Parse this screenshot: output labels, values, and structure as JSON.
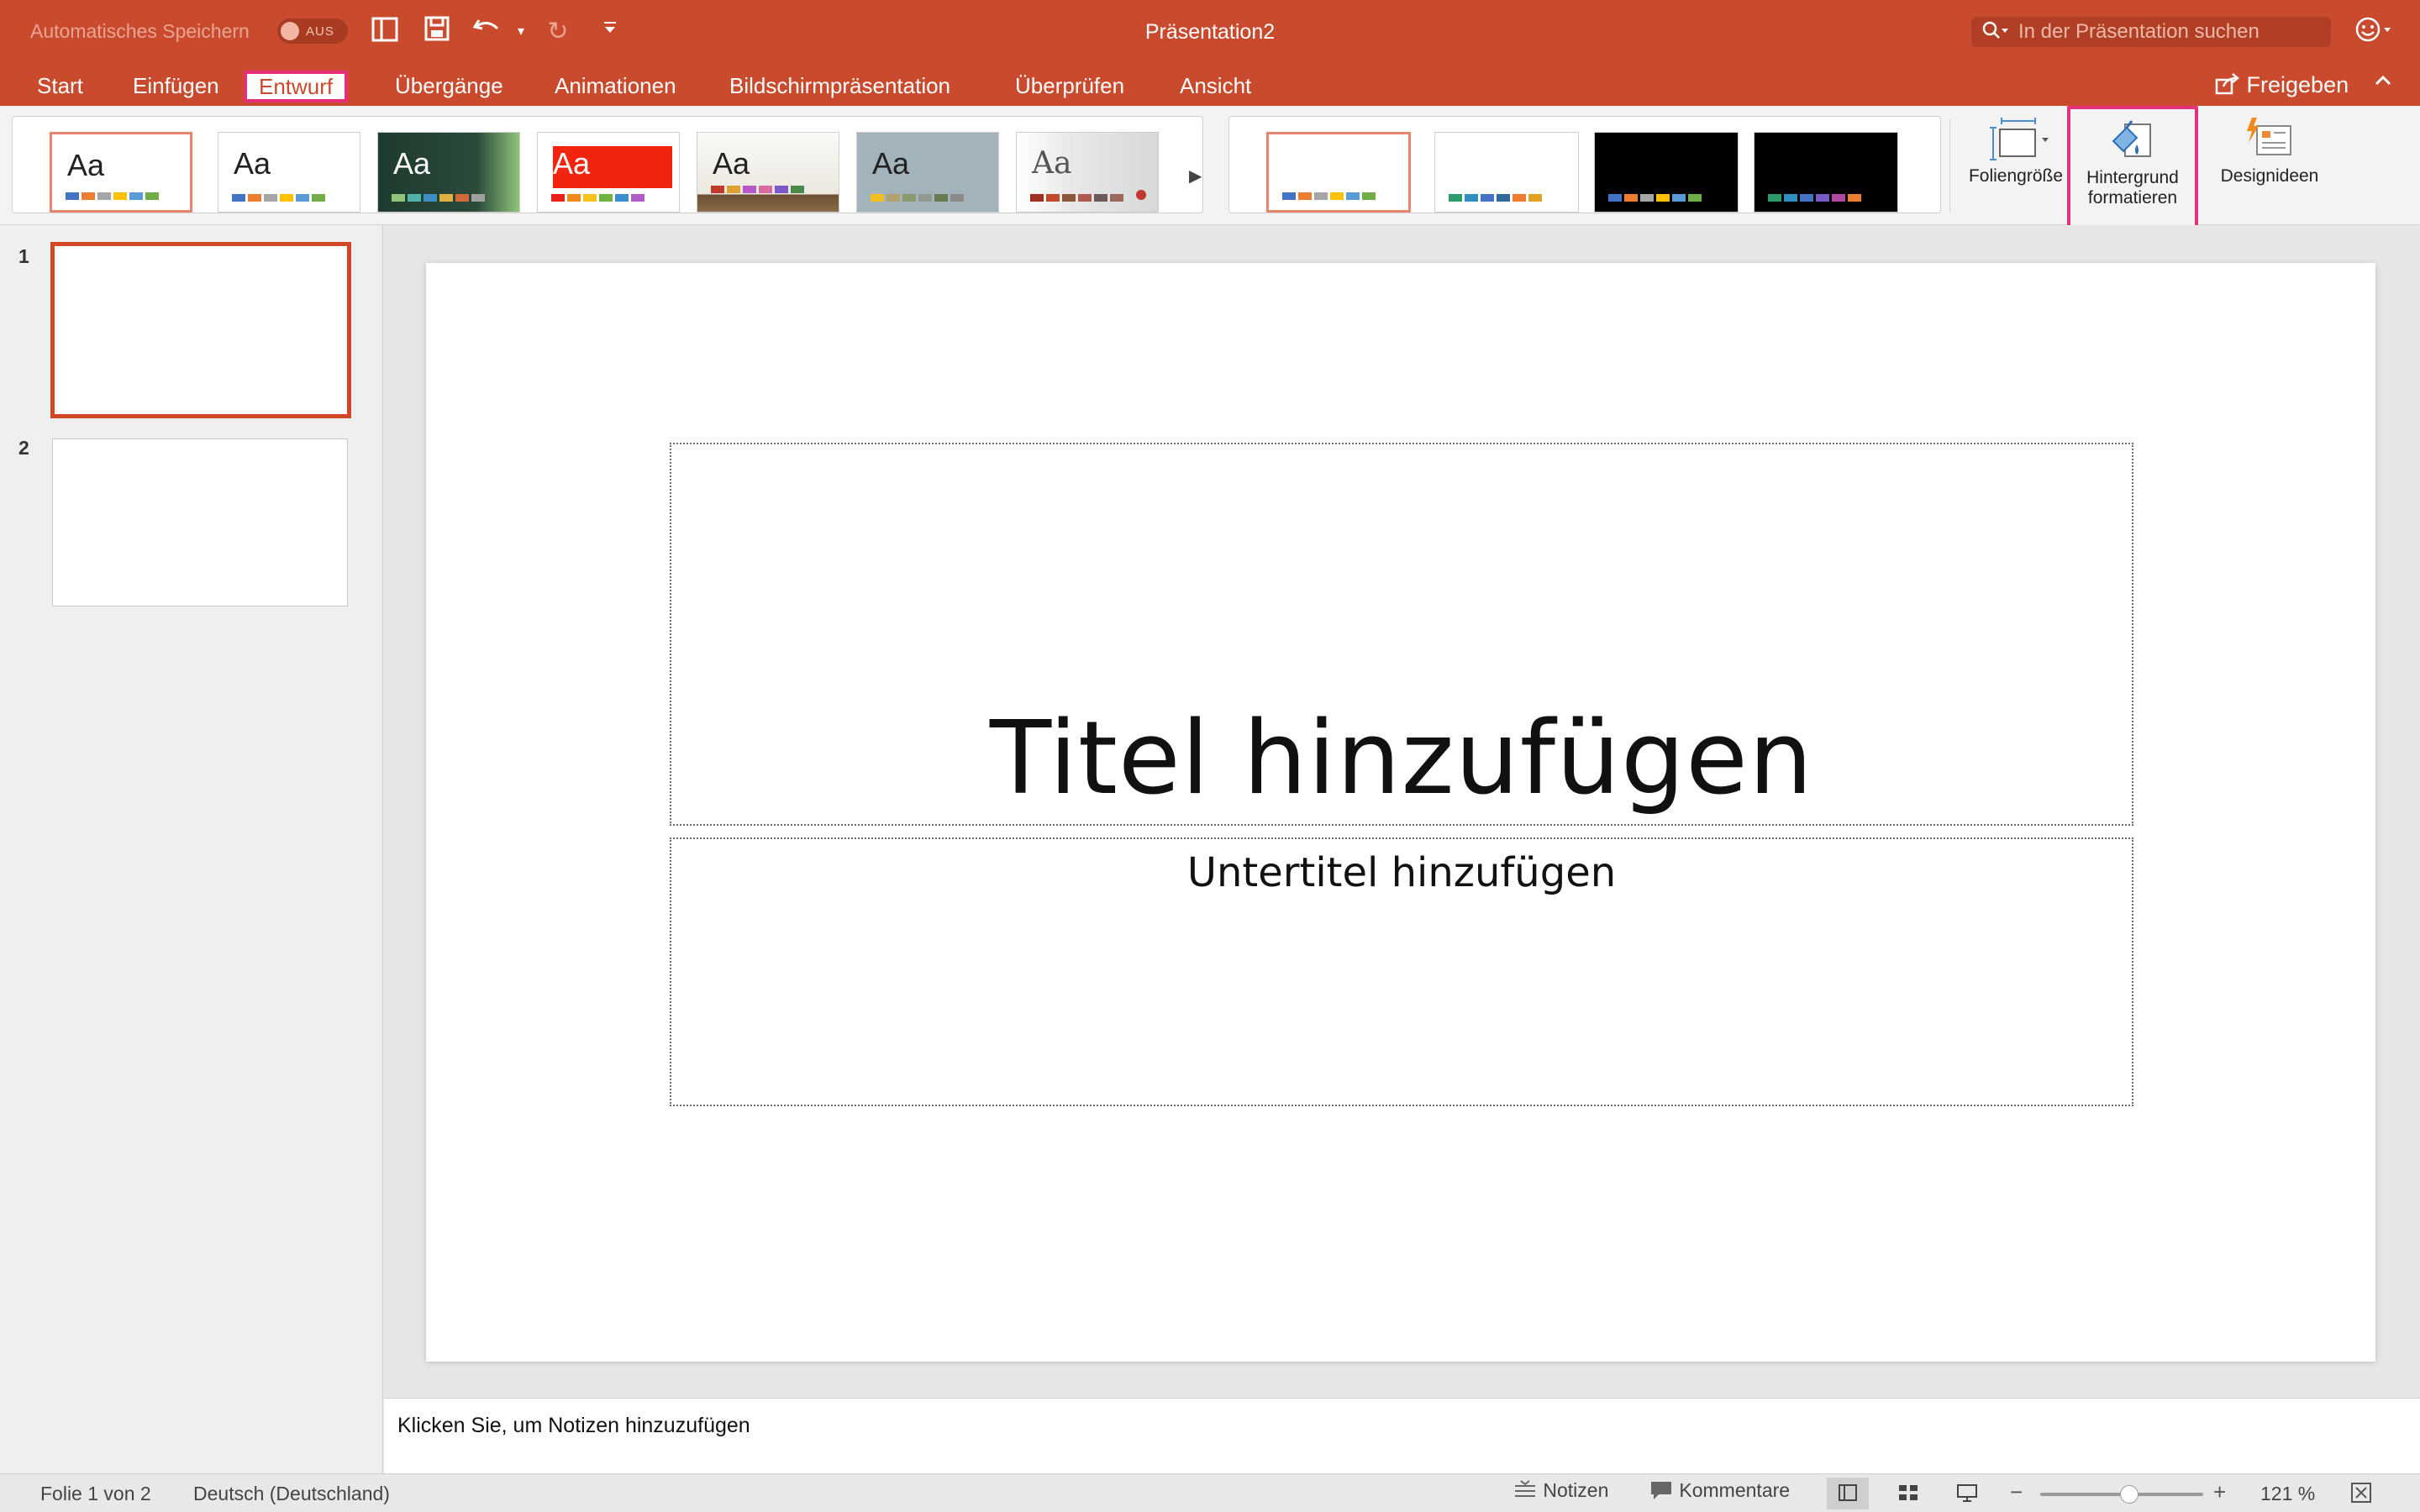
{
  "titlebar": {
    "autosave_label": "Automatisches Speichern",
    "autosave_toggle": "AUS",
    "document_title": "Präsentation2",
    "search_placeholder": "In der Präsentation suchen"
  },
  "tabs": [
    {
      "label": "Start"
    },
    {
      "label": "Einfügen"
    },
    {
      "label": "Entwurf",
      "active": true
    },
    {
      "label": "Übergänge"
    },
    {
      "label": "Animationen"
    },
    {
      "label": "Bildschirmpräsentation"
    },
    {
      "label": "Überprüfen"
    },
    {
      "label": "Ansicht"
    }
  ],
  "share_label": "Freigeben",
  "themes": {
    "glyph": "Aa",
    "colors": {
      "accent_blue": "#4472c4",
      "accent_orange": "#ed7d31",
      "accent_gray": "#a5a5a5",
      "accent_yellow": "#ffc000",
      "accent_green": "#70ad47",
      "brand_red": "#c94a2d",
      "highlight_pink": "#e8307a"
    }
  },
  "ribbon": {
    "slide_size_label": "Foliengröße",
    "format_background_line1": "Hintergrund",
    "format_background_line2": "formatieren",
    "design_ideas_label": "Designideen"
  },
  "thumbnails": [
    {
      "number": "1",
      "selected": true
    },
    {
      "number": "2",
      "selected": false
    }
  ],
  "slide": {
    "title_placeholder": "Titel hinzufügen",
    "subtitle_placeholder": "Untertitel hinzufügen"
  },
  "notes_placeholder": "Klicken Sie, um Notizen hinzuzufügen",
  "statusbar": {
    "slide_counter": "Folie 1 von 2",
    "language": "Deutsch (Deutschland)",
    "notes_label": "Notizen",
    "comments_label": "Kommentare",
    "zoom_level": "121 %",
    "zoom_fraction": 0.55
  }
}
